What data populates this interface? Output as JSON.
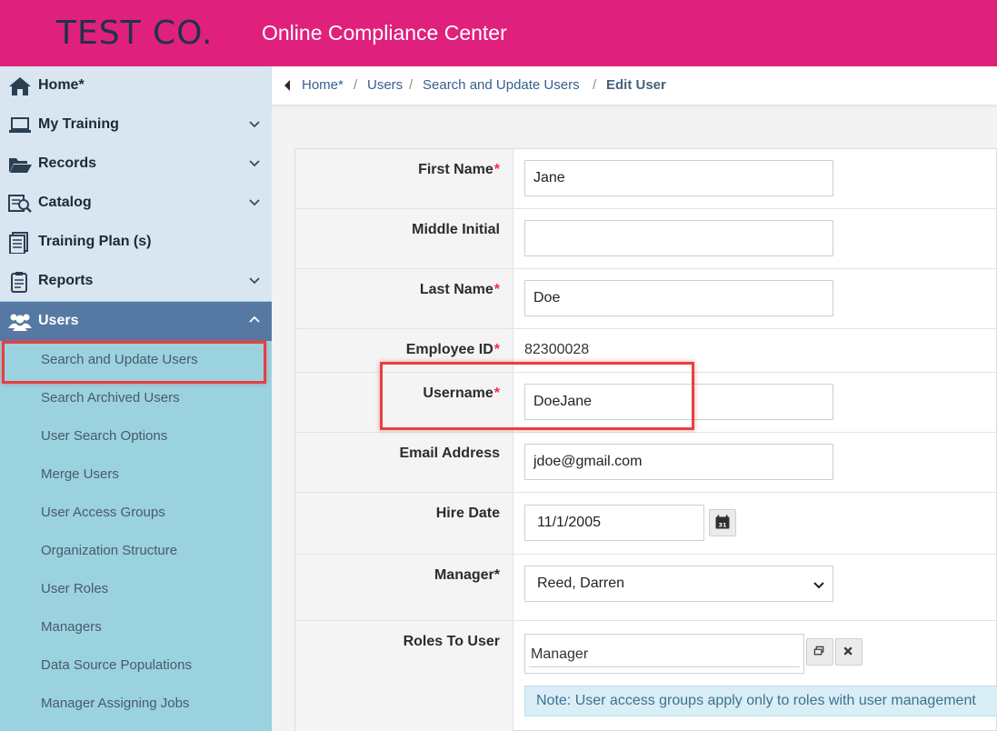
{
  "header": {
    "brand": "TEST CO.",
    "app_title": "Online Compliance Center",
    "background": "#e0207d"
  },
  "sidebar": {
    "items": [
      {
        "label": "Home*",
        "icon": "home-icon"
      },
      {
        "label": "My Training",
        "icon": "laptop-icon"
      },
      {
        "label": "Records",
        "icon": "folder-open-icon"
      },
      {
        "label": "Catalog",
        "icon": "catalog-search-icon"
      },
      {
        "label": "Training Plan (s)",
        "icon": "document-list-icon"
      },
      {
        "label": "Reports",
        "icon": "clipboard-icon"
      },
      {
        "label": "Users",
        "icon": "users-icon"
      }
    ],
    "users_submenu": [
      "Search and Update Users",
      "Search Archived Users",
      "User Search Options",
      "Merge Users",
      "User Access Groups",
      "Organization Structure",
      "User Roles",
      "Managers",
      "Data Source Populations",
      "Manager Assigning Jobs"
    ],
    "active_color": "#5679a3",
    "submenu_color": "#9ad2df"
  },
  "breadcrumb": {
    "items": [
      "Home*",
      "Users",
      "Search and Update Users",
      "Edit User"
    ],
    "separator": "/"
  },
  "form": {
    "required_marker": "*",
    "first_name": {
      "label": "First Name",
      "value": "Jane"
    },
    "middle_initial": {
      "label": "Middle Initial",
      "value": ""
    },
    "last_name": {
      "label": "Last Name",
      "value": "Doe"
    },
    "employee_id": {
      "label": "Employee ID",
      "value": "82300028"
    },
    "username": {
      "label": "Username",
      "value": "DoeJane"
    },
    "email": {
      "label": "Email Address",
      "value": "jdoe@gmail.com"
    },
    "hire_date": {
      "label": "Hire Date",
      "value": "11/1/2005"
    },
    "manager": {
      "label": "Manager*",
      "value": "Reed, Darren"
    },
    "roles": {
      "label": "Roles To User",
      "value": "Manager"
    },
    "note": "Note: User access groups apply only to roles with user management"
  },
  "highlight_color": "#e84040"
}
